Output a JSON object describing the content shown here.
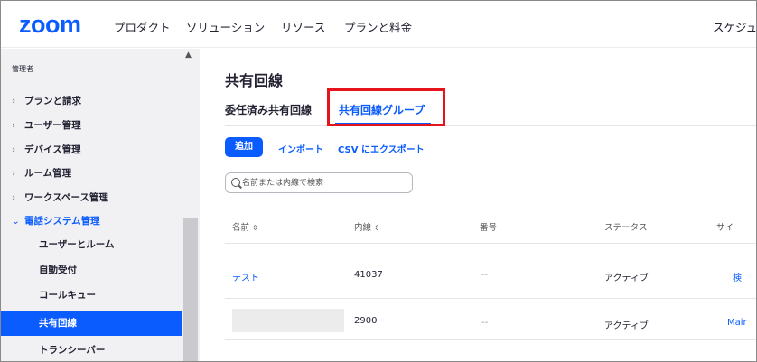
{
  "app": {
    "logo": "zoom",
    "nav": [
      "プロダクト",
      "ソリューション",
      "リソース",
      "プランと料金"
    ],
    "nav_right": "スケジュ"
  },
  "sidebar": {
    "section_label": "管理者",
    "items": [
      {
        "label": "プランと請求",
        "chevron": "›"
      },
      {
        "label": "ユーザー管理",
        "chevron": "›"
      },
      {
        "label": "デバイス管理",
        "chevron": "›"
      },
      {
        "label": "ルーム管理",
        "chevron": "›"
      },
      {
        "label": "ワークスペース管理",
        "chevron": "›"
      },
      {
        "label": "電話システム管理",
        "chevron": "⌄"
      }
    ],
    "subitems": [
      "ユーザーとルーム",
      "自動受付",
      "コールキュー",
      "共有回線",
      "トランシーバー"
    ],
    "active_subitem": "共有回線",
    "scroll_up": "▲"
  },
  "main": {
    "title": "共有回線",
    "tabs": [
      {
        "label": "委任済み共有回線",
        "active": false
      },
      {
        "label": "共有回線グループ",
        "active": true
      }
    ],
    "actions": {
      "add": "追加",
      "import": "インポート",
      "export_csv": "CSV にエクスポート"
    },
    "search": {
      "placeholder": "名前または内線で検索",
      "value": ""
    },
    "table": {
      "columns": [
        {
          "label": "名前",
          "sortable": true
        },
        {
          "label": "内線",
          "sortable": true
        },
        {
          "label": "番号",
          "sortable": false
        },
        {
          "label": "ステータス",
          "sortable": false
        },
        {
          "label": "サイ",
          "sortable": false
        }
      ],
      "sort_glyph": "⇕",
      "rows": [
        {
          "name": "テスト",
          "extension": "41037",
          "number": "--",
          "status": "アクティブ",
          "site": "検"
        },
        {
          "name": "",
          "extension": "2900",
          "number": "--",
          "status": "アクティブ",
          "site": "Mair"
        }
      ]
    }
  },
  "colors": {
    "accent": "#0b5cff",
    "highlight": "#e5141a",
    "sidebar_bg": "#f1f1f4"
  }
}
